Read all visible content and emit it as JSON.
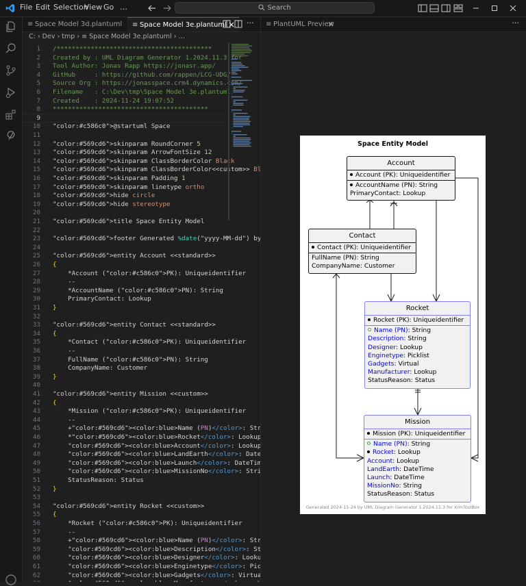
{
  "menu": [
    "File",
    "Edit",
    "Selection",
    "View",
    "Go",
    "…"
  ],
  "search": "Search",
  "tabs_left": [
    {
      "label": "Space Model 3d.plantuml",
      "active": false
    },
    {
      "label": "Space Model 3e.plantuml",
      "active": true,
      "close": "×"
    }
  ],
  "tab_right": {
    "label": "PlantUML Preview",
    "close": "×"
  },
  "more": "···",
  "breadcrumb": "C: › Dev › tmp › ≡ Space Model 3e.plantuml › …",
  "current_line": "9",
  "lines": [
    {
      "n": "1",
      "t": "/*****************************************"
    },
    {
      "n": "2",
      "t": "Created by : UML Diagram Generator 1.2024.11.3 for"
    },
    {
      "n": "3",
      "t": "Tool Author: Jonas Rapp https://jonasr.app/"
    },
    {
      "n": "4",
      "t": "GitHub     : https://github.com/rappen/LCG-UDG/"
    },
    {
      "n": "5",
      "t": "Source Org : https://jonasspace.crm4.dynamics.com/"
    },
    {
      "n": "6",
      "t": "Filename   : C:\\Dev\\tmp\\Space Model 3e.plantuml"
    },
    {
      "n": "7",
      "t": "Created    : 2024-11-24 19:07:52"
    },
    {
      "n": "8",
      "t": "*****************************************"
    },
    {
      "n": "9",
      "t": ""
    },
    {
      "n": "10",
      "t": "@startuml Space"
    },
    {
      "n": "11",
      "t": ""
    },
    {
      "n": "12",
      "t": "skinparam RoundCorner 5"
    },
    {
      "n": "13",
      "t": "skinparam ArrowFontSize 12"
    },
    {
      "n": "14",
      "t": "skinparam ClassBorderColor Black"
    },
    {
      "n": "15",
      "t": "skinparam ClassBorderColor<<custom>> Blue"
    },
    {
      "n": "16",
      "t": "skinparam Padding 1"
    },
    {
      "n": "17",
      "t": "skinparam linetype ortho"
    },
    {
      "n": "18",
      "t": "hide circle"
    },
    {
      "n": "19",
      "t": "hide stereotype"
    },
    {
      "n": "20",
      "t": ""
    },
    {
      "n": "21",
      "t": "title Space Entity Model"
    },
    {
      "n": "22",
      "t": ""
    },
    {
      "n": "23",
      "t": "footer Generated %date(\"yyyy-MM-dd\") by UML Diagra"
    },
    {
      "n": "24",
      "t": ""
    },
    {
      "n": "25",
      "t": "entity Account <<standard>>"
    },
    {
      "n": "26",
      "t": "{"
    },
    {
      "n": "27",
      "t": "    *Account (PK): Uniqueidentifier"
    },
    {
      "n": "28",
      "t": "    --"
    },
    {
      "n": "29",
      "t": "    *AccountName (PN): String"
    },
    {
      "n": "30",
      "t": "    PrimaryContact: Lookup"
    },
    {
      "n": "31",
      "t": "}"
    },
    {
      "n": "32",
      "t": ""
    },
    {
      "n": "33",
      "t": "entity Contact <<standard>>"
    },
    {
      "n": "34",
      "t": "{"
    },
    {
      "n": "35",
      "t": "    *Contact (PK): Uniqueidentifier"
    },
    {
      "n": "36",
      "t": "    --"
    },
    {
      "n": "37",
      "t": "    FullName (PN): String"
    },
    {
      "n": "38",
      "t": "    CompanyName: Customer"
    },
    {
      "n": "39",
      "t": "}"
    },
    {
      "n": "40",
      "t": ""
    },
    {
      "n": "41",
      "t": "entity Mission <<custom>>"
    },
    {
      "n": "42",
      "t": "{"
    },
    {
      "n": "43",
      "t": "    *Mission (PK): Uniqueidentifier"
    },
    {
      "n": "44",
      "t": "    --"
    },
    {
      "n": "45",
      "t": "    +<color:blue>Name (PN)</color>: String"
    },
    {
      "n": "46",
      "t": "    *<color:blue>Rocket</color>: Lookup"
    },
    {
      "n": "47",
      "t": "    <color:blue>Account</color>: Lookup"
    },
    {
      "n": "48",
      "t": "    <color:blue>LandEarth</color>: DateTime"
    },
    {
      "n": "49",
      "t": "    <color:blue>Launch</color>: DateTime"
    },
    {
      "n": "50",
      "t": "    <color:blue>MissionNo</color>: String"
    },
    {
      "n": "51",
      "t": "    StatusReason: Status"
    },
    {
      "n": "52",
      "t": "}"
    },
    {
      "n": "53",
      "t": ""
    },
    {
      "n": "54",
      "t": "entity Rocket <<custom>>"
    },
    {
      "n": "55",
      "t": "{"
    },
    {
      "n": "56",
      "t": "    *Rocket (PK): Uniqueidentifier"
    },
    {
      "n": "57",
      "t": "    --"
    },
    {
      "n": "58",
      "t": "    +<color:blue>Name (PN)</color>: String"
    },
    {
      "n": "59",
      "t": "    <color:blue>Description</color>: String"
    },
    {
      "n": "60",
      "t": "    <color:blue>Designer</color>: Lookup"
    },
    {
      "n": "61",
      "t": "    <color:blue>Enginetype</color>: Picklist"
    },
    {
      "n": "62",
      "t": "    <color:blue>Gadgets</color>: Virtual"
    },
    {
      "n": "63",
      "t": "    <color:blue>Manufacturer</color>: Lookup"
    }
  ],
  "diagram": {
    "title": "Space Entity Model",
    "footer": "Generated 2024-11-24 by UML Diagram Generator 1.2024.11.3 for XrmToolBox",
    "entities": {
      "account": {
        "name": "Account",
        "pk": "Account (PK): Uniqueidentifier",
        "attrs": [
          {
            "mark": "dot",
            "name": "AccountName (PN)",
            "type": ": String",
            "blue": false
          },
          {
            "mark": "none",
            "name": "PrimaryContact",
            "type": ": Lookup",
            "blue": false
          }
        ]
      },
      "contact": {
        "name": "Contact",
        "pk": "Contact (PK): Uniqueidentifier",
        "attrs": [
          {
            "mark": "none",
            "name": "FullName (PN)",
            "type": ": String",
            "blue": false
          },
          {
            "mark": "none",
            "name": "CompanyName",
            "type": ": Customer",
            "blue": false
          }
        ]
      },
      "rocket": {
        "name": "Rocket",
        "pk": "Rocket (PK): Uniqueidentifier",
        "attrs": [
          {
            "mark": "green",
            "name": "Name (PN)",
            "type": ": String",
            "blue": true
          },
          {
            "mark": "none",
            "name": "Description",
            "type": ": String",
            "blue": true
          },
          {
            "mark": "none",
            "name": "Designer",
            "type": ": Lookup",
            "blue": true
          },
          {
            "mark": "none",
            "name": "Enginetype",
            "type": ": Picklist",
            "blue": true
          },
          {
            "mark": "none",
            "name": "Gadgets",
            "type": ": Virtual",
            "blue": true
          },
          {
            "mark": "none",
            "name": "Manufacturer",
            "type": ": Lookup",
            "blue": true
          },
          {
            "mark": "none",
            "name": "StatusReason",
            "type": ": Status",
            "blue": false
          }
        ]
      },
      "mission": {
        "name": "Mission",
        "pk": "Mission (PK): Uniqueidentifier",
        "attrs": [
          {
            "mark": "green",
            "name": "Name (PN)",
            "type": ": String",
            "blue": true
          },
          {
            "mark": "dot",
            "name": "Rocket",
            "type": ": Lookup",
            "blue": true
          },
          {
            "mark": "none",
            "name": "Account",
            "type": ": Lookup",
            "blue": true
          },
          {
            "mark": "none",
            "name": "LandEarth",
            "type": ": DateTime",
            "blue": true
          },
          {
            "mark": "none",
            "name": "Launch",
            "type": ": DateTime",
            "blue": true
          },
          {
            "mark": "none",
            "name": "MissionNo",
            "type": ": String",
            "blue": true
          },
          {
            "mark": "none",
            "name": "StatusReason",
            "type": ": Status",
            "blue": false
          }
        ]
      }
    }
  },
  "colors": {
    "keyword": "#569cd6",
    "comment": "#6a9955",
    "string": "#ce9178",
    "number": "#b5cea8",
    "accent": "#0078d4",
    "type": "#4ec9b0",
    "directive": "#c586c0"
  }
}
